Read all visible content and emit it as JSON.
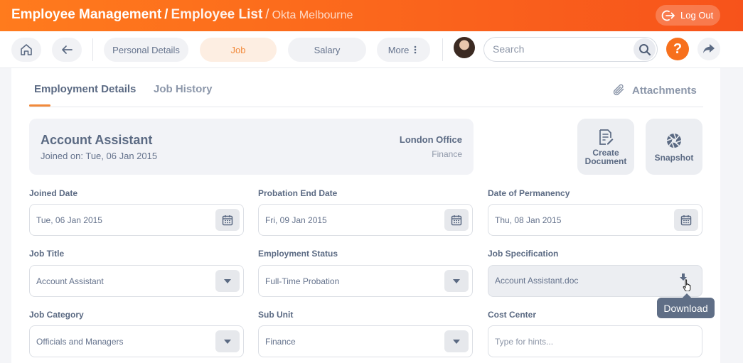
{
  "header": {
    "breadcrumb": [
      "Employee Management",
      "Employee List",
      "Okta Melbourne"
    ],
    "separator": "/",
    "logout_label": "Log Out"
  },
  "toolbar": {
    "tabs": [
      "Personal Details",
      "Job",
      "Salary",
      "More"
    ],
    "active_tab": "Job",
    "search_placeholder": "Search",
    "help_label": "?"
  },
  "subtabs": {
    "items": [
      "Employment Details",
      "Job History"
    ],
    "active": "Employment Details",
    "attachments_label": "Attachments"
  },
  "summary": {
    "job_title": "Account Assistant",
    "joined_text": "Joined on: Tue, 06 Jan 2015",
    "office": "London Office",
    "department": "Finance"
  },
  "actions": {
    "create_document": [
      "Create",
      "Document"
    ],
    "snapshot": "Snapshot"
  },
  "form": {
    "joined_date": {
      "label": "Joined Date",
      "value": "Tue, 06 Jan 2015"
    },
    "probation_end_date": {
      "label": "Probation End Date",
      "value": "Fri, 09 Jan 2015"
    },
    "date_of_permanency": {
      "label": "Date of Permanency",
      "value": "Thu, 08 Jan 2015"
    },
    "job_title": {
      "label": "Job Title",
      "value": "Account Assistant"
    },
    "employment_status": {
      "label": "Employment Status",
      "value": "Full-Time Probation"
    },
    "job_specification": {
      "label": "Job Specification",
      "value": "Account Assistant.doc"
    },
    "job_category": {
      "label": "Job Category",
      "value": "Officials and Managers"
    },
    "sub_unit": {
      "label": "Sub Unit",
      "value": "Finance"
    },
    "cost_center": {
      "label": "Cost Center",
      "placeholder": "Type for hints..."
    }
  },
  "tooltip": {
    "text": "Download"
  },
  "colors": {
    "accent": "#f7701d",
    "accent_light": "#fdeee2",
    "text": "#5b6a83"
  }
}
